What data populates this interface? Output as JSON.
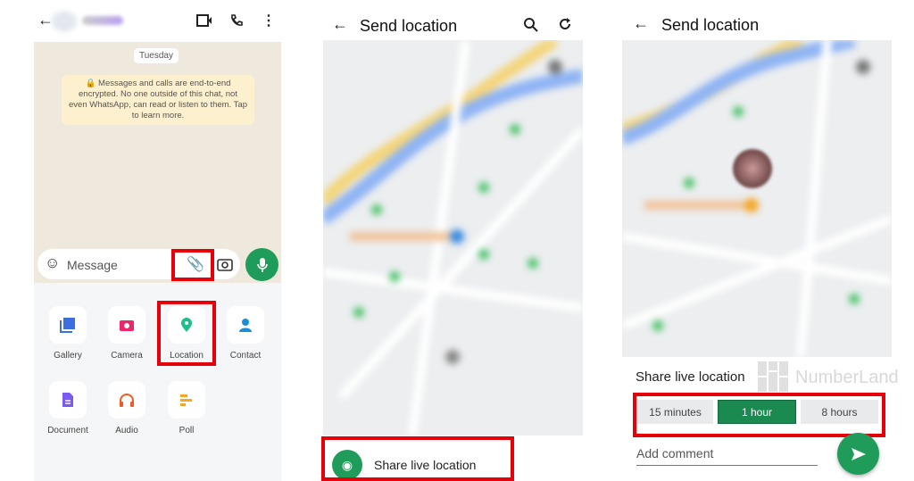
{
  "panel1": {
    "date_chip": "Tuesday",
    "encryption_notice": "Messages and calls are end-to-end encrypted. No one outside of this chat, not even WhatsApp, can read or listen to them. Tap to learn more.",
    "message_placeholder": "Message",
    "attachments": [
      {
        "label": "Gallery",
        "icon": "gallery-icon",
        "color": "#3b6fe0"
      },
      {
        "label": "Camera",
        "icon": "camera-icon",
        "color": "#f0246b"
      },
      {
        "label": "Location",
        "icon": "location-pin-icon",
        "color": "#1dbf8a"
      },
      {
        "label": "Contact",
        "icon": "person-icon",
        "color": "#1a8fd6"
      },
      {
        "label": "Document",
        "icon": "document-icon",
        "color": "#7a5af0"
      },
      {
        "label": "Audio",
        "icon": "headphones-icon",
        "color": "#f25a24"
      },
      {
        "label": "Poll",
        "icon": "poll-icon",
        "color": "#f5a623"
      }
    ]
  },
  "panel2": {
    "title": "Send location",
    "share_live": "Share live location"
  },
  "panel3": {
    "title": "Send location",
    "share_live": "Share live location",
    "durations": [
      "15 minutes",
      "1 hour",
      "8 hours"
    ],
    "selected_duration": "1 hour",
    "comment_placeholder": "Add comment"
  },
  "watermark": "NumberLand",
  "colors": {
    "green": "#1f9c5a",
    "selected": "#1a8a50",
    "highlight": "#e5000a"
  }
}
